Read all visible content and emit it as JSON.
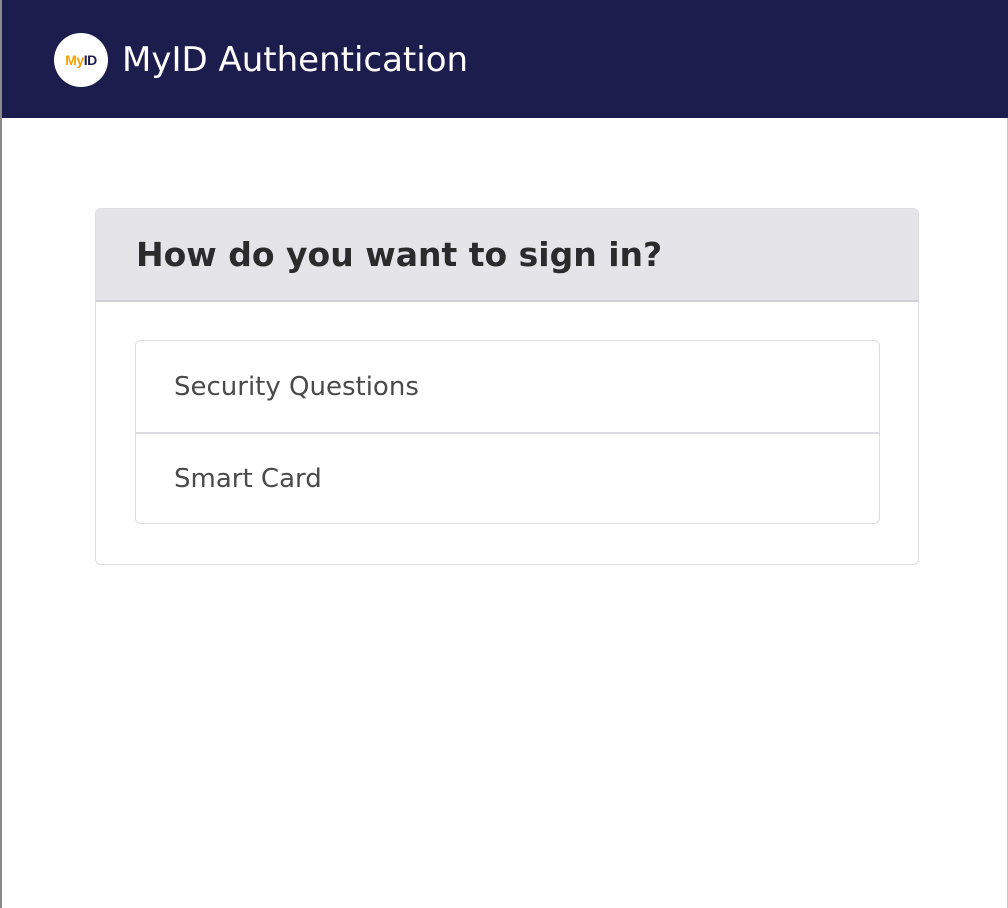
{
  "header": {
    "logo_my": "My",
    "logo_id": "ID",
    "app_title": "MyID Authentication"
  },
  "sign_in_card": {
    "title": "How do you want to sign in?",
    "options": [
      {
        "label": "Security Questions"
      },
      {
        "label": "Smart Card"
      }
    ]
  },
  "colors": {
    "header_background": "#1c1c4d",
    "logo_accent": "#f5a000",
    "card_header_background": "#e4e4e9"
  }
}
